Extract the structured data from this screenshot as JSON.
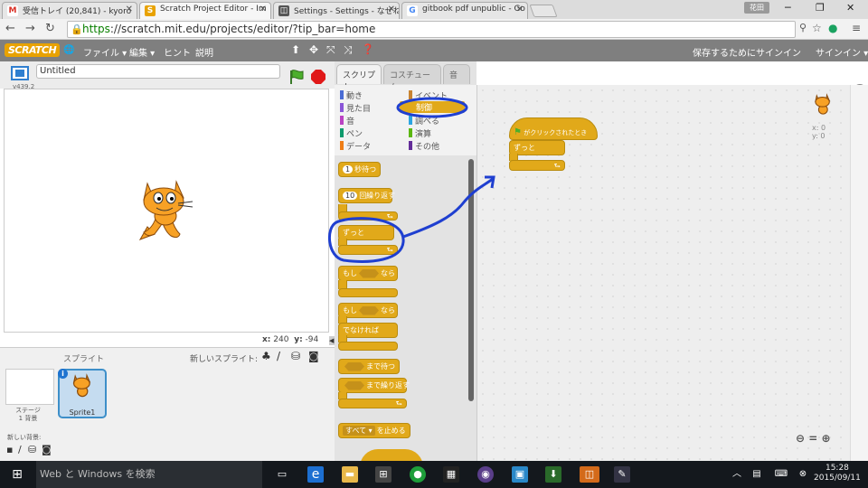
{
  "browser": {
    "tabs": [
      {
        "label": "受信トレイ (20,841) - kyoro",
        "icon": "gmail-icon",
        "color": "#d93025"
      },
      {
        "label": "Scratch Project Editor - Im",
        "icon": "scratch-icon",
        "color": "#e8a200"
      },
      {
        "label": "Settings - Settings - なぜね",
        "icon": "book-icon",
        "color": "#555555"
      },
      {
        "label": "gitbook pdf unpublic - Go",
        "icon": "google-icon",
        "color": "#4285f4"
      }
    ],
    "user_badge": "花田",
    "url_scheme": "https",
    "url_rest": "://scratch.mit.edu/projects/editor/?tip_bar=home"
  },
  "menu": {
    "logo": "SCRATCH",
    "file": "ファイル ▾",
    "edit": "編集 ▾",
    "hint": "ヒント",
    "about": "説明",
    "save_prompt": "保存するためにサインイン",
    "signin": "サインイン ▾"
  },
  "stage": {
    "project_title": "Untitled",
    "version": "v439.2",
    "x_label": "x:",
    "x_value": "240",
    "y_label": "y:",
    "y_value": "-94"
  },
  "sprites": {
    "header": "スプライト",
    "new_sprite": "新しいスプライト:",
    "stage_label": "ステージ",
    "stage_count": "1 背景",
    "new_backdrop": "新しい背景:",
    "sprite_name": "Sprite1"
  },
  "palette": {
    "tabs": [
      "スクリプト",
      "コスチューム",
      "音"
    ],
    "categories_left": [
      {
        "label": "動き",
        "color": "#4a6cd4"
      },
      {
        "label": "見た目",
        "color": "#8a55d7"
      },
      {
        "label": "音",
        "color": "#bb42c3"
      },
      {
        "label": "ペン",
        "color": "#0e9a6c"
      },
      {
        "label": "データ",
        "color": "#ee7d16"
      }
    ],
    "categories_right": [
      {
        "label": "イベント",
        "color": "#c88330"
      },
      {
        "label": "制御",
        "color": "#e1a91a"
      },
      {
        "label": "調べる",
        "color": "#2ca5e2"
      },
      {
        "label": "演算",
        "color": "#5cb712"
      },
      {
        "label": "その他",
        "color": "#632d99"
      }
    ],
    "blocks": {
      "wait_num": "1",
      "wait": "秒待つ",
      "repeat_num": "10",
      "repeat": "回繰り返す",
      "forever": "ずっと",
      "if_1": "もし",
      "if_2": "なら",
      "ifelse_1": "もし",
      "ifelse_2": "なら",
      "else": "でなければ",
      "wait_until": "まで待つ",
      "repeat_until": "まで繰り返す",
      "stop_dropdown": "すべて ▾",
      "stop": "を止める"
    }
  },
  "scripts": {
    "hat": "がクリックされたとき",
    "forever": "ずっと",
    "sprite_x": "x: 0",
    "sprite_y": "y: 0"
  },
  "taskbar": {
    "search": "Web と Windows を検索",
    "time": "15:28",
    "date": "2015/09/11"
  },
  "colors": {
    "control": "#e1a91a",
    "annotation": "#1f3fd0"
  }
}
